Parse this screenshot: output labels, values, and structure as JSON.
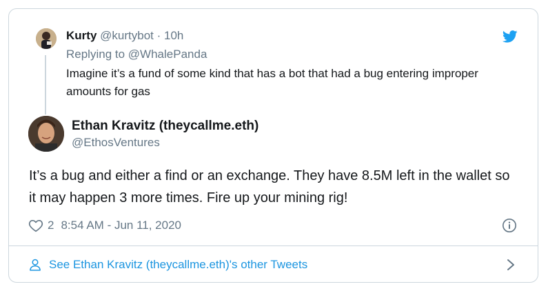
{
  "colors": {
    "border": "#ccd6dd",
    "muted": "#657786",
    "link": "#1b95e0",
    "twitter_blue": "#1da1f2",
    "text": "#14171a"
  },
  "quoted_tweet": {
    "author_name": "Kurty",
    "author_handle": "@kurtybot",
    "separator": "·",
    "time": "10h",
    "replying_prefix": "Replying to",
    "replying_to": "@WhalePanda",
    "text": "Imagine it’s a fund of some kind that has a bot that had a bug entering improper amounts for gas"
  },
  "tweet": {
    "author_name": "Ethan Kravitz (theycallme.eth)",
    "author_handle": "@EthosVentures",
    "text": "It’s a bug and either a find or an exchange. They have 8.5M left in the wallet so it may happen 3 more times. Fire up your mining rig!",
    "like_count": "2",
    "timestamp": "8:54 AM - Jun 11, 2020"
  },
  "footer": {
    "label": "See Ethan Kravitz (theycallme.eth)'s other Tweets"
  },
  "icons": [
    "twitter-bird-icon",
    "heart-icon",
    "info-icon",
    "user-icon",
    "chevron-right-icon"
  ]
}
